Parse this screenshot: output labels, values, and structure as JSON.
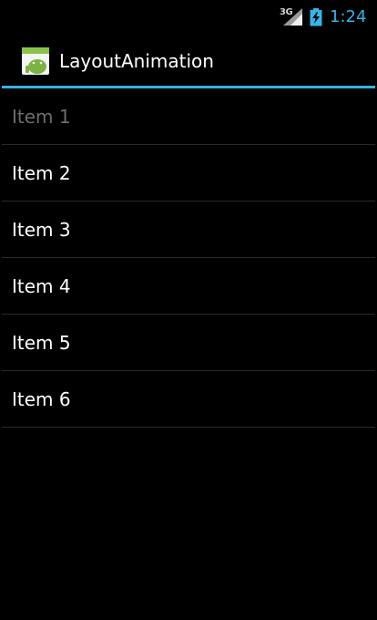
{
  "status_bar": {
    "network": "3G",
    "signal_icon": "signal-strength-icon",
    "battery_icon": "battery-charging-icon",
    "time": "1:24",
    "accent_color": "#33b5e5"
  },
  "action_bar": {
    "app_icon": "android-app-icon",
    "title": "LayoutAnimation",
    "divider_color": "#33b5e5"
  },
  "list": {
    "items": [
      {
        "label": "Item 1",
        "state": "faded"
      },
      {
        "label": "Item 2",
        "state": "normal"
      },
      {
        "label": "Item 3",
        "state": "normal"
      },
      {
        "label": "Item 4",
        "state": "normal"
      },
      {
        "label": "Item 5",
        "state": "normal"
      },
      {
        "label": "Item 6",
        "state": "normal"
      }
    ]
  }
}
